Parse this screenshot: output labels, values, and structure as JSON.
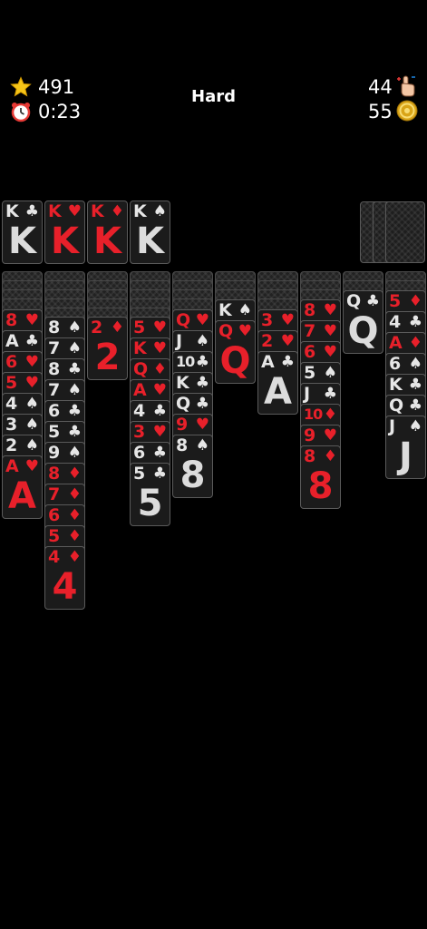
{
  "hud": {
    "score": "491",
    "time": "0:23",
    "difficulty": "Hard",
    "moves": "44",
    "coins": "55"
  },
  "colors": {
    "red": "#e8202a",
    "black": "#e6e6e6",
    "background": "#000000"
  },
  "icons": {
    "score": "star-icon",
    "time": "alarm-clock-icon",
    "moves": "tap-hand-icon",
    "coins": "coin-icon"
  },
  "foundations": [
    {
      "rank": "K",
      "suit": "♣",
      "color": "black"
    },
    {
      "rank": "K",
      "suit": "♥",
      "color": "red"
    },
    {
      "rank": "K",
      "suit": "♦",
      "color": "red"
    },
    {
      "rank": "K",
      "suit": "♠",
      "color": "black"
    }
  ],
  "tableau": [
    [
      {
        "rank": "8",
        "suit": "♥",
        "color": "red"
      },
      {
        "rank": "A",
        "suit": "♣",
        "color": "black"
      },
      {
        "rank": "6",
        "suit": "♥",
        "color": "red"
      },
      {
        "rank": "5",
        "suit": "♥",
        "color": "red"
      },
      {
        "rank": "4",
        "suit": "♠",
        "color": "black"
      },
      {
        "rank": "3",
        "suit": "♠",
        "color": "black"
      },
      {
        "rank": "2",
        "suit": "♠",
        "color": "black"
      },
      {
        "rank": "A",
        "suit": "♥",
        "color": "red"
      }
    ],
    [
      {
        "rank": "8",
        "suit": "♠",
        "color": "black"
      },
      {
        "rank": "7",
        "suit": "♠",
        "color": "black"
      },
      {
        "rank": "8",
        "suit": "♣",
        "color": "black"
      },
      {
        "rank": "7",
        "suit": "♠",
        "color": "black"
      },
      {
        "rank": "6",
        "suit": "♣",
        "color": "black"
      },
      {
        "rank": "5",
        "suit": "♣",
        "color": "black"
      },
      {
        "rank": "9",
        "suit": "♠",
        "color": "black"
      },
      {
        "rank": "8",
        "suit": "♦",
        "color": "red"
      },
      {
        "rank": "7",
        "suit": "♦",
        "color": "red"
      },
      {
        "rank": "6",
        "suit": "♦",
        "color": "red"
      },
      {
        "rank": "5",
        "suit": "♦",
        "color": "red"
      },
      {
        "rank": "4",
        "suit": "♦",
        "color": "red"
      }
    ],
    [
      {
        "rank": "2",
        "suit": "♦",
        "color": "red"
      }
    ],
    [
      {
        "rank": "5",
        "suit": "♥",
        "color": "red"
      },
      {
        "rank": "K",
        "suit": "♥",
        "color": "red"
      },
      {
        "rank": "Q",
        "suit": "♦",
        "color": "red"
      },
      {
        "rank": "A",
        "suit": "♥",
        "color": "red"
      },
      {
        "rank": "4",
        "suit": "♣",
        "color": "black"
      },
      {
        "rank": "3",
        "suit": "♥",
        "color": "red"
      },
      {
        "rank": "6",
        "suit": "♣",
        "color": "black"
      },
      {
        "rank": "5",
        "suit": "♣",
        "color": "black"
      }
    ],
    [
      {
        "rank": "Q",
        "suit": "♥",
        "color": "red"
      },
      {
        "rank": "J",
        "suit": "♠",
        "color": "black"
      },
      {
        "rank": "10",
        "suit": "♣",
        "color": "black"
      },
      {
        "rank": "K",
        "suit": "♣",
        "color": "black"
      },
      {
        "rank": "Q",
        "suit": "♣",
        "color": "black"
      },
      {
        "rank": "9",
        "suit": "♥",
        "color": "red"
      },
      {
        "rank": "8",
        "suit": "♠",
        "color": "black"
      }
    ],
    [
      {
        "rank": "K",
        "suit": "♠",
        "color": "black"
      },
      {
        "rank": "Q",
        "suit": "♥",
        "color": "red"
      }
    ],
    [
      {
        "rank": "3",
        "suit": "♥",
        "color": "red"
      },
      {
        "rank": "2",
        "suit": "♥",
        "color": "red"
      },
      {
        "rank": "A",
        "suit": "♣",
        "color": "black"
      }
    ],
    [
      {
        "rank": "8",
        "suit": "♥",
        "color": "red"
      },
      {
        "rank": "7",
        "suit": "♥",
        "color": "red"
      },
      {
        "rank": "6",
        "suit": "♥",
        "color": "red"
      },
      {
        "rank": "5",
        "suit": "♠",
        "color": "black"
      },
      {
        "rank": "J",
        "suit": "♣",
        "color": "black"
      },
      {
        "rank": "10",
        "suit": "♦",
        "color": "red"
      },
      {
        "rank": "9",
        "suit": "♥",
        "color": "red"
      },
      {
        "rank": "8",
        "suit": "♦",
        "color": "red"
      }
    ],
    [
      {
        "rank": "Q",
        "suit": "♣",
        "color": "black"
      }
    ],
    [
      {
        "rank": "5",
        "suit": "♦",
        "color": "red"
      },
      {
        "rank": "4",
        "suit": "♣",
        "color": "black"
      },
      {
        "rank": "A",
        "suit": "♦",
        "color": "red"
      },
      {
        "rank": "6",
        "suit": "♠",
        "color": "black"
      },
      {
        "rank": "K",
        "suit": "♣",
        "color": "black"
      },
      {
        "rank": "Q",
        "suit": "♣",
        "color": "black"
      },
      {
        "rank": "J",
        "suit": "♠",
        "color": "black"
      }
    ]
  ]
}
